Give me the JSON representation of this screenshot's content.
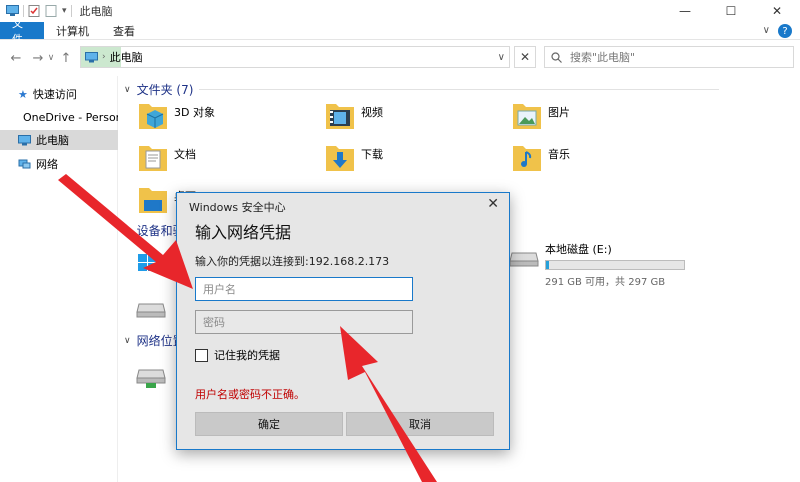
{
  "window": {
    "title": "此电脑",
    "controls": {
      "minimize": "—",
      "maximize": "☐",
      "close": "✕"
    }
  },
  "ribbon": {
    "tabs": [
      "文件",
      "计算机",
      "查看"
    ],
    "help": "?"
  },
  "address": {
    "path": "此电脑",
    "search_placeholder": "搜索\"此电脑\""
  },
  "sidebar": {
    "items": [
      {
        "label": "快速访问",
        "icon": "star-icon"
      },
      {
        "label": "OneDrive - Persona",
        "icon": "cloud-icon"
      },
      {
        "label": "此电脑",
        "icon": "computer-icon",
        "active": true
      },
      {
        "label": "网络",
        "icon": "network-icon"
      }
    ]
  },
  "folders": {
    "header": "文件夹 (7)",
    "items": [
      "3D 对象",
      "视频",
      "图片",
      "文档",
      "下载",
      "音乐",
      "桌面"
    ]
  },
  "devices": {
    "header": "设备和驱",
    "drive_e": {
      "label": "本地磁盘 (E:)",
      "free_text": "291 GB 可用，共 297 GB",
      "used_fraction": 0.02
    }
  },
  "network": {
    "header": "网络位置"
  },
  "dialog": {
    "title": "Windows 安全中心",
    "close": "✕",
    "heading": "输入网络凭据",
    "subtitle": "输入你的凭据以连接到:192.168.2.173",
    "username_placeholder": "用户名",
    "password_placeholder": "密码",
    "remember_label": "记住我的凭据",
    "error": "用户名或密码不正确。",
    "ok_label": "确定",
    "cancel_label": "取消"
  },
  "colors": {
    "accent": "#1979ca",
    "error": "#c00000",
    "arrow": "#e8262b",
    "folder": "#f0c24a"
  }
}
